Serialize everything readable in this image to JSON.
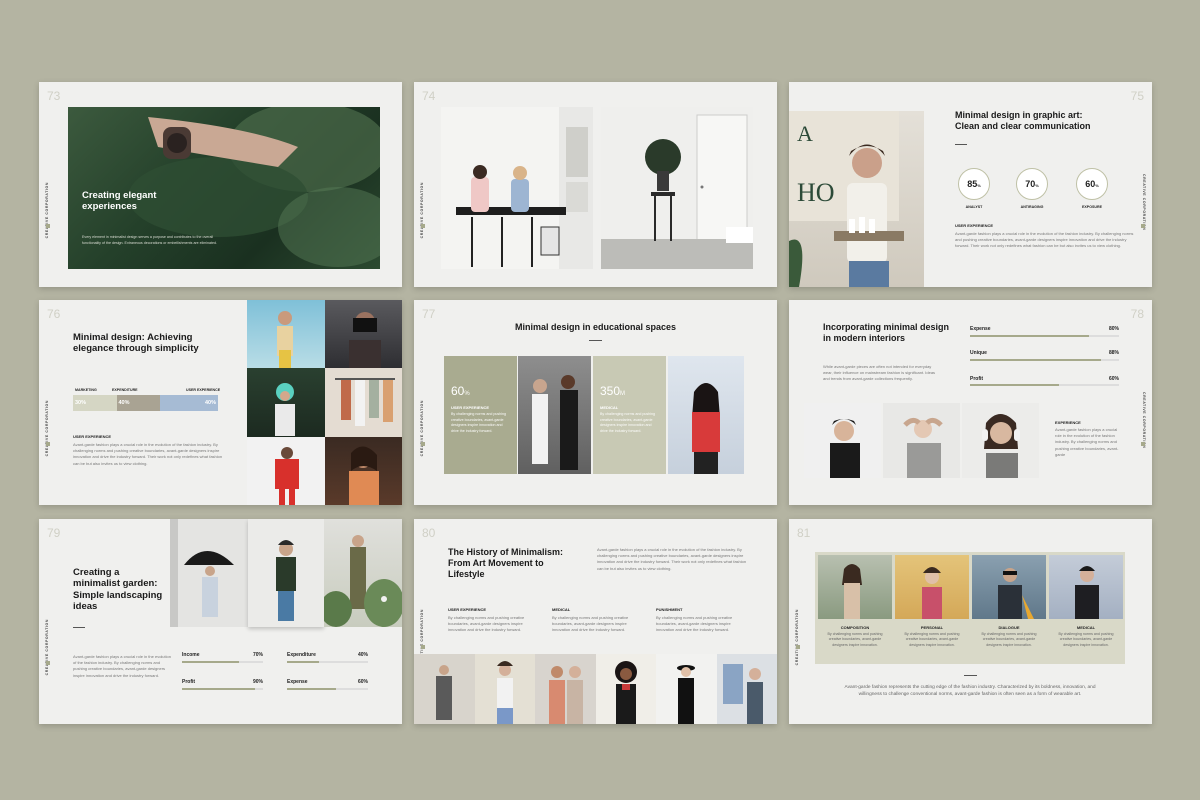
{
  "side_label": "CREATIVE CORPORATION",
  "colors": {
    "background": "#b4b4a2",
    "accent": "#a6a98b",
    "slide": "#f0f0ee"
  },
  "slides": {
    "s73": {
      "number": "73",
      "title": "Creating elegant experiences",
      "body": "Every element in minimalist design serves a purpose and contributes to the overall functionality of the design. Extraneous decorations or embellishments are eliminated."
    },
    "s74": {
      "number": "74"
    },
    "s75": {
      "number": "75",
      "title": "Minimal design in graphic art: Clean and clear communication",
      "stats": [
        {
          "value": "85",
          "unit": "%",
          "label": "ANALYST",
          "fraction": 0.85
        },
        {
          "value": "70",
          "unit": "%",
          "label": "ANTIRAGING",
          "fraction": 0.7
        },
        {
          "value": "60",
          "unit": "%",
          "label": "EXPOSURE",
          "fraction": 0.6
        }
      ],
      "sub_heading": "USER EXPERIENCE",
      "body": "Avant-garde fashion plays a crucial role in the evolution of the fashion industry. By challenging norms and pushing creative boundaries, avant-garde designers inspire innovation and drive the industry forward. Their work not only redefines what fashion can be but also invites us to view clothing."
    },
    "s76": {
      "number": "76",
      "title": "Minimal design: Achieving elegance through simplicity",
      "bar_labels": [
        "MARKETING",
        "EXPENDITURE",
        "USER EXPERIENCE"
      ],
      "bar_segments": [
        {
          "value": "30%",
          "fraction": 0.3,
          "color": "#d5d6c4"
        },
        {
          "value": "40%",
          "fraction": 0.3,
          "color": "#a9a393"
        },
        {
          "value": "40%",
          "fraction": 0.4,
          "color": "#a6bbd4"
        }
      ],
      "sub_heading": "USER EXPERIENCE",
      "body": "Avant-garde fashion plays a crucial role in the evolution of the fashion industry. By challenging norms and pushing creative boundaries, avant-garde designers inspire innovation and drive the industry forward. Their work not only redefines what fashion can be but also invites us to view clothing."
    },
    "s77": {
      "number": "77",
      "title": "Minimal design in educational spaces",
      "card1": {
        "value": "60",
        "unit": "%",
        "label": "USER EXPERIENCE",
        "body": "By challenging norms and pushing creative boundaries, avant-garde designers inspire innovation and drive the industry forward."
      },
      "card2": {
        "value": "350",
        "unit": "M",
        "label": "MEDICAL",
        "body": "By challenging norms and pushing creative boundaries, avant-garde designers inspire innovation and drive the industry forward."
      }
    },
    "s78": {
      "number": "78",
      "title": "Incorporating minimal design in modern interiors",
      "body": "While avant-garde pieces are often not intended for everyday wear, their influence on mainstream fashion is significant. Ideas and trends from avant-garde collections frequently.",
      "bars": [
        {
          "label": "Expense",
          "value": "80%",
          "fraction": 0.8
        },
        {
          "label": "Unique",
          "value": "88%",
          "fraction": 0.88
        },
        {
          "label": "Profit",
          "value": "60%",
          "fraction": 0.6
        }
      ],
      "sub_heading": "EXPERIENCE",
      "sub_body": "Avant-garde fashion plays a crucial role in the evolution of the fashion industry. By challenging norms and pushing creative boundaries, avant-garde"
    },
    "s79": {
      "number": "79",
      "title": "Creating a minimalist garden: Simple landscaping ideas",
      "body": "Avant-garde fashion plays a crucial role in the evolution of the fashion industry. By challenging norms and pushing creative boundaries, avant-garde designers inspire innovation and drive the industry forward.",
      "bars": [
        {
          "label": "Income",
          "value": "70%",
          "fraction": 0.7
        },
        {
          "label": "Expenditure",
          "value": "40%",
          "fraction": 0.4
        },
        {
          "label": "Profit",
          "value": "90%",
          "fraction": 0.9
        },
        {
          "label": "Expense",
          "value": "60%",
          "fraction": 0.6
        }
      ]
    },
    "s80": {
      "number": "80",
      "title": "The History of Minimalism: From Art Movement to Lifestyle",
      "intro": "Avant-garde fashion plays a crucial role in the evolution of the fashion industry. By challenging norms and pushing creative boundaries, avant-garde designers inspire innovation and drive the industry forward. Their work not only redefines what fashion can be but also invites us to view clothing.",
      "columns": [
        {
          "label": "USER EXPERIENCE",
          "body": "By challenging norms and pushing creative boundaries, avant-garde designers inspire innovation and drive the industry forward."
        },
        {
          "label": "MEDICAL",
          "body": "By challenging norms and pushing creative boundaries, avant-garde designers inspire innovation and drive the industry forward."
        },
        {
          "label": "PUNISHMENT",
          "body": "By challenging norms and pushing creative boundaries, avant-garde designers inspire innovation and drive the industry forward."
        }
      ]
    },
    "s81": {
      "number": "81",
      "cards": [
        {
          "label": "COMPOSITION",
          "body": "By challenging norms and pushing creative boundaries, avant-garde designers inspire innovation."
        },
        {
          "label": "PERSONAL",
          "body": "By challenging norms and pushing creative boundaries, avant-garde designers inspire innovation."
        },
        {
          "label": "DIALOGUE",
          "body": "By challenging norms and pushing creative boundaries, avant-garde designers inspire innovation."
        },
        {
          "label": "MEDICAL",
          "body": "By challenging norms and pushing creative boundaries, avant-garde designers inspire innovation."
        }
      ],
      "footer": "Avant-garde fashion represents the cutting edge of the fashion industry. Characterized by its boldness, innovation, and willingness to challenge conventional norms, avant-garde fashion is often seen as a form of wearable art."
    }
  }
}
